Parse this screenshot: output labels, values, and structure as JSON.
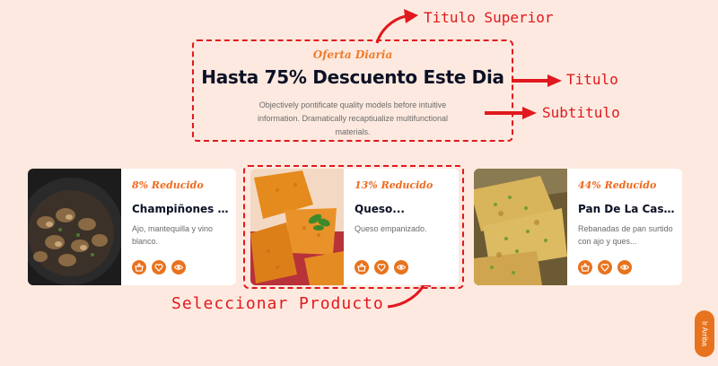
{
  "header": {
    "kicker": "Oferta Diaria",
    "title": "Hasta 75% Descuento Este Dia",
    "subtitle": "Objectively pontificate quality models before intuitive information. Dramatically recaptiualize multifunctional materials."
  },
  "annotations": {
    "top_title": "Titulo Superior",
    "title": "Titulo",
    "subtitle": "Subtitulo",
    "select": "Seleccionar Producto"
  },
  "products": [
    {
      "discount": "8% Reducido",
      "name": "Champiñones ...",
      "description": "Ajo, mantequilla y vino blanco."
    },
    {
      "discount": "13% Reducido",
      "name": "Queso...",
      "description": "Queso empanizado."
    },
    {
      "discount": "44% Reducido",
      "name": "Pan De La Cas...",
      "description": "Rebanadas de pan surtido con ajo y ques..."
    }
  ],
  "icons": {
    "basket": "basket-icon",
    "heart": "heart-icon",
    "eye": "eye-icon"
  },
  "go_top": "Ir Arriba",
  "colors": {
    "accent": "#e8731e",
    "annotation": "#e0191e",
    "background": "#fde9df",
    "title": "#0c1126"
  }
}
